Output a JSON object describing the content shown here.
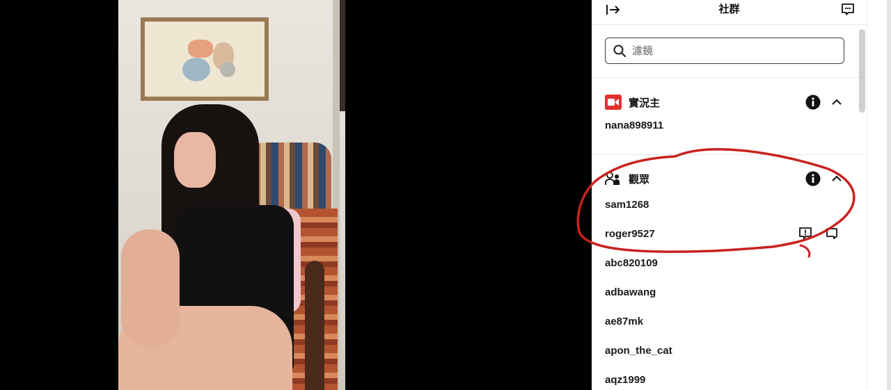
{
  "panel": {
    "title": "社群",
    "filter_placeholder": "濾鏡"
  },
  "sections": {
    "broadcaster": {
      "label": "實況主",
      "users": [
        "nana898911"
      ]
    },
    "viewers": {
      "label": "觀眾",
      "users": [
        "sam1268",
        "roger9527",
        "abc820109",
        "adbawang",
        "ae87mk",
        "apon_the_cat",
        "aqz1999"
      ]
    }
  },
  "colors": {
    "broadcaster_icon": "#e0312f",
    "annotation_ink": "#c8221f",
    "panel_bg": "#ffffff",
    "video_bg": "#000000"
  },
  "icons": {
    "collapse_panel": "arrow-right-bar-icon",
    "chat_bubble": "chat-bubble-icon",
    "search": "search-icon",
    "camera": "video-camera-icon",
    "viewers": "people-icon",
    "info": "info-icon",
    "collapse_section": "chevron-up-icon",
    "report": "report-bubble-icon",
    "whisper": "whisper-bubble-icon"
  }
}
